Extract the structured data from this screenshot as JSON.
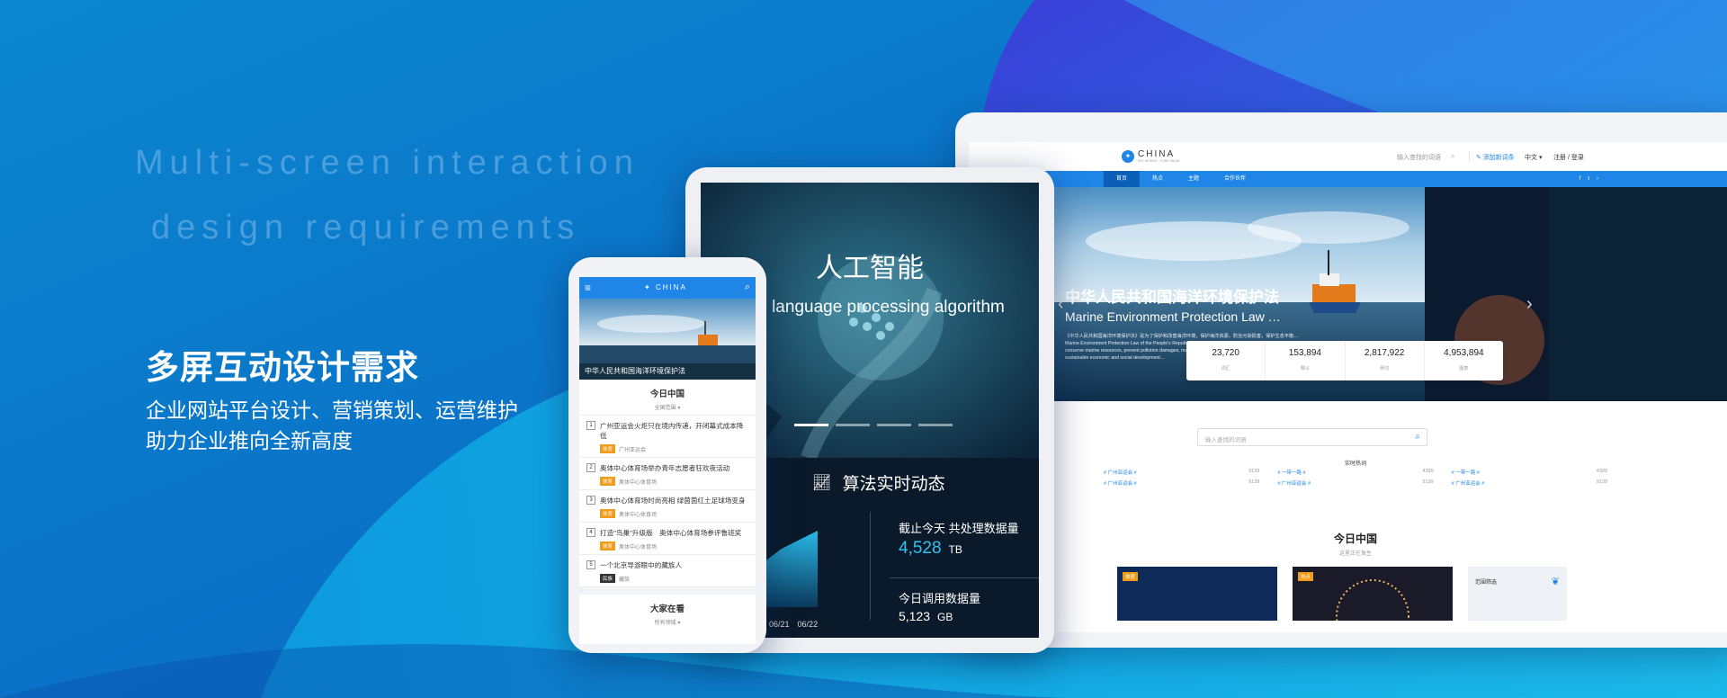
{
  "hero": {
    "en_line1": "Multi-screen interaction",
    "en_line2": "design requirements",
    "title": "多屏互动设计需求",
    "sub_line1": "企业网站平台设计、营销策划、运营维护",
    "sub_line2": "助力企业推向全新高度"
  },
  "laptop": {
    "logo": "CHINA",
    "logo_tagline": "KEY WORDS · CORE VALUE",
    "search_placeholder": "输入查找的词语",
    "add_words": "添加新词条",
    "lang": "中文",
    "login": "注册 / 登录",
    "nav": [
      "首页",
      "热点",
      "主题",
      "合作伙伴"
    ],
    "banner_title": "中华人民共和国海洋环境保护法",
    "banner_subtitle": "Marine Environment Protection Law …",
    "banner_desc_cn": "《中华人民共和国海洋环境保护法》是为了保护和改善海洋环境，保护海洋资源，防治污染损害，保护生态平衡…",
    "banner_desc_en": "Marine Environment Protection Law of the People's Republic of China is enacted to protect and improve the marine environment, conserve marine resources, prevent pollution damages, maintain ecological balance, safeguard human health and promote sustainable economic and social development…",
    "stats": [
      {
        "value": "23,720",
        "label": "词汇"
      },
      {
        "value": "153,894",
        "label": "释义"
      },
      {
        "value": "2,817,922",
        "label": "例句"
      },
      {
        "value": "4,953,894",
        "label": "图表"
      }
    ],
    "search2_placeholder": "输入查找的词语",
    "hot_title": "实时热词",
    "hot_words": [
      {
        "word": "# 广州亚运会 #",
        "count": "9139"
      },
      {
        "word": "# 一带一路 #",
        "count": "4399"
      },
      {
        "word": "# 一带一路 #",
        "count": "4399"
      },
      {
        "word": "# 广州亚运会 #",
        "count": "9139"
      },
      {
        "word": "# 广州亚运会 #",
        "count": "9139"
      },
      {
        "word": "# 广州亚运会 #",
        "count": "9139"
      }
    ],
    "today_title": "今日中国",
    "today_sub": "这里正在发生",
    "card_tags": [
      "体育",
      "热点"
    ],
    "filter_label": "范围筛选"
  },
  "tablet": {
    "banner_title": "人工智能",
    "banner_subtitle": "ural language processing algorithm",
    "section_title": "算法实时动态",
    "axis_labels": [
      "20",
      "06/21",
      "06/22"
    ],
    "stat1_label": "截止今天 共处理数据量",
    "stat1_value": "4,528",
    "stat1_unit": "TB",
    "stat2_label": "今日调用数据量",
    "stat2_value": "5,123",
    "stat2_unit": "GB"
  },
  "phone": {
    "logo": "CHINA",
    "banner_caption": "中华人民共和国海洋环境保护法",
    "section1_title": "今日中国",
    "section1_filter": "全国范围",
    "news": [
      {
        "num": "1",
        "title": "广州亚运会火炬只在境内传递，开闭幕式成本降低",
        "tag": "体育",
        "source": "广州亚运会",
        "dark": false
      },
      {
        "num": "2",
        "title": "奥体中心体育场举办青年志愿者狂欢夜活动",
        "tag": "体育",
        "source": "奥体中心体育场",
        "dark": false
      },
      {
        "num": "3",
        "title": "奥体中心体育场时尚亮相 绿茵茵红土足球场变身",
        "tag": "体育",
        "source": "奥体中心体育场",
        "dark": false
      },
      {
        "num": "4",
        "title": "打造\"鸟巢\"升级版　奥体中心体育场参评鲁班奖",
        "tag": "体育",
        "source": "奥体中心体育场",
        "dark": false
      },
      {
        "num": "5",
        "title": "一个北京导游眼中的藏族人",
        "tag": "民族",
        "source": "藏族",
        "dark": true
      }
    ],
    "section2_title": "大家在看",
    "section2_filter": "所有领域"
  }
}
